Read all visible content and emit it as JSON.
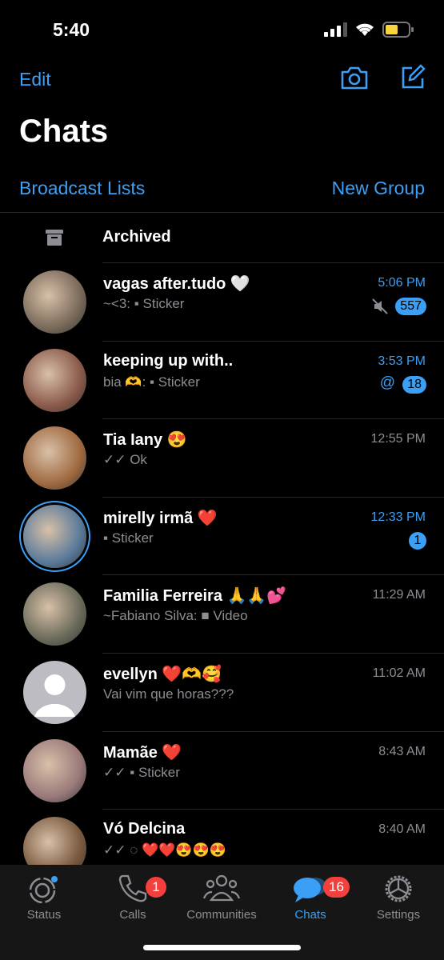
{
  "status_bar": {
    "time": "5:40"
  },
  "header": {
    "edit": "Edit",
    "title": "Chats",
    "broadcast": "Broadcast Lists",
    "new_group": "New Group"
  },
  "archived": {
    "label": "Archived"
  },
  "accent": "#3a9ff5",
  "chats": [
    {
      "name": "vagas after.tudo 🤍",
      "preview": "~<3: ▪ Sticker",
      "time": "5:06 PM",
      "unread": true,
      "muted": true,
      "badge": "557",
      "avatar_color": "#7a6a5a"
    },
    {
      "name": "keeping up with..",
      "preview": "bia 🫶: ▪ Sticker",
      "time": "3:53 PM",
      "unread": true,
      "mention": "@",
      "badge": "18",
      "avatar_color": "#8a5a4a"
    },
    {
      "name": "Tia Iany 😍",
      "preview": "✓✓ Ok",
      "time": "12:55 PM",
      "unread": false,
      "avatar_color": "#a06a40"
    },
    {
      "name": "mirelly irmã ❤️",
      "preview": "▪ Sticker",
      "time": "12:33 PM",
      "unread": true,
      "badge": "1",
      "avatar_color": "#5a7a9a",
      "status_ring": true
    },
    {
      "name": "Familia Ferreira 🙏🙏💕",
      "preview": "~Fabiano Silva: ■ Video",
      "time": "11:29 AM",
      "unread": false,
      "avatar_color": "#6a6a5a"
    },
    {
      "name": "evellyn ❤️🫶🥰",
      "preview": "Vai vim que horas???",
      "time": "11:02 AM",
      "unread": false,
      "avatar_color": "default"
    },
    {
      "name": "Mamãe ❤️",
      "preview": "✓✓ ▪ Sticker",
      "time": "8:43 AM",
      "unread": false,
      "avatar_color": "#9a7a7a"
    },
    {
      "name": "Vó Delcina",
      "preview": "✓✓ ◌ ❤️❤️😍😍😍",
      "time": "8:40 AM",
      "unread": false,
      "avatar_color": "#7a5a40"
    }
  ],
  "tabs": [
    {
      "label": "Status",
      "icon": "status-icon"
    },
    {
      "label": "Calls",
      "icon": "phone-icon",
      "badge": "1"
    },
    {
      "label": "Communities",
      "icon": "communities-icon"
    },
    {
      "label": "Chats",
      "icon": "chats-icon",
      "badge": "16",
      "active": true
    },
    {
      "label": "Settings",
      "icon": "gear-icon"
    }
  ]
}
